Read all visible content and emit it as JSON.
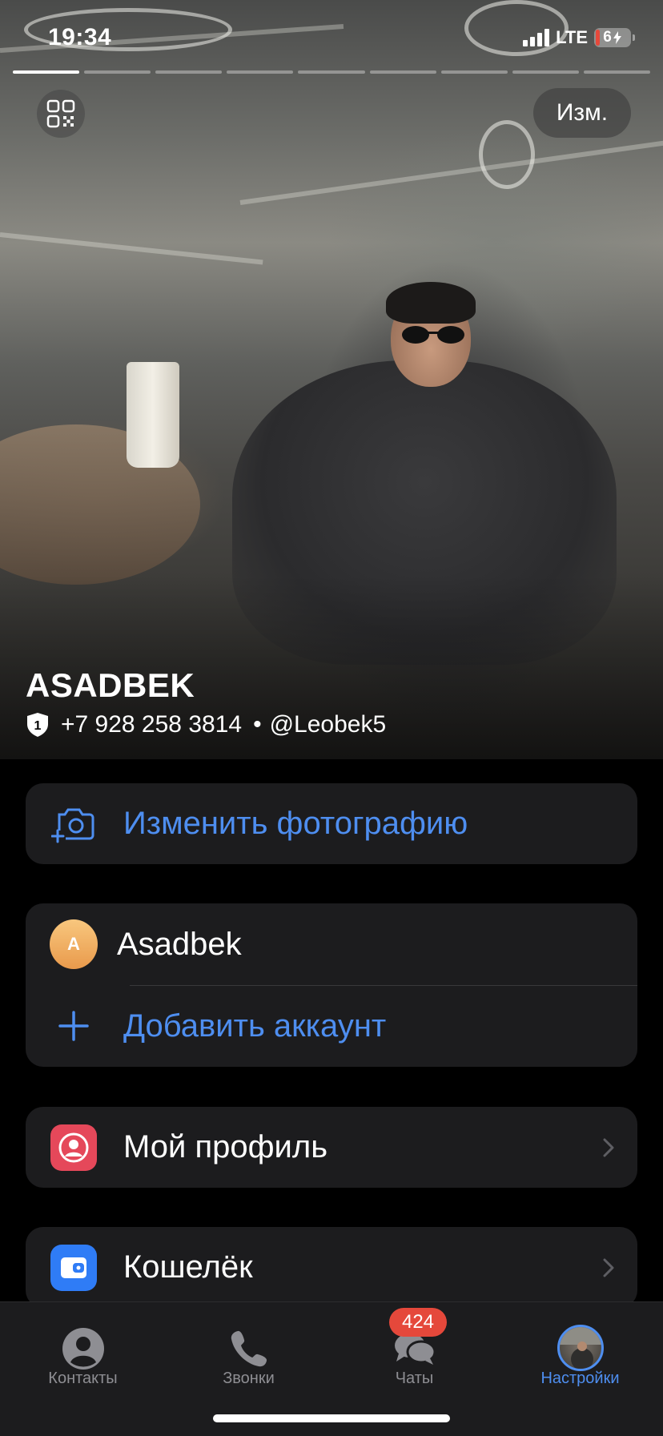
{
  "status_bar": {
    "time": "19:34",
    "network": "LTE",
    "battery": "6"
  },
  "header": {
    "edit_label": "Изм.",
    "qr_icon": "qr-code-icon",
    "name": "ASADBEK",
    "phone": "+7 928 258 3814",
    "separator": "•",
    "username": "@Leobek5",
    "shield_number": "1"
  },
  "photo_card": {
    "label": "Изменить фотографию",
    "icon": "camera-add-icon"
  },
  "accounts": {
    "current": {
      "initial": "A",
      "name": "Asadbek"
    },
    "add_label": "Добавить аккаунт",
    "add_icon": "plus-icon"
  },
  "menu": [
    {
      "label": "Мой профиль",
      "icon": "person-icon",
      "color": "#e5485a"
    },
    {
      "label": "Кошелёк",
      "icon": "wallet-icon",
      "color": "#2f7cf6"
    }
  ],
  "tabbar": {
    "tabs": [
      {
        "label": "Контакты",
        "icon": "person-circle-icon"
      },
      {
        "label": "Звонки",
        "icon": "phone-icon"
      },
      {
        "label": "Чаты",
        "icon": "chat-bubbles-icon",
        "badge": "424"
      },
      {
        "label": "Настройки",
        "icon": "profile-avatar-icon",
        "active": true
      }
    ]
  },
  "colors": {
    "accent": "#4e8ef0",
    "card_bg": "#1c1c1e",
    "badge": "#e5483b"
  }
}
